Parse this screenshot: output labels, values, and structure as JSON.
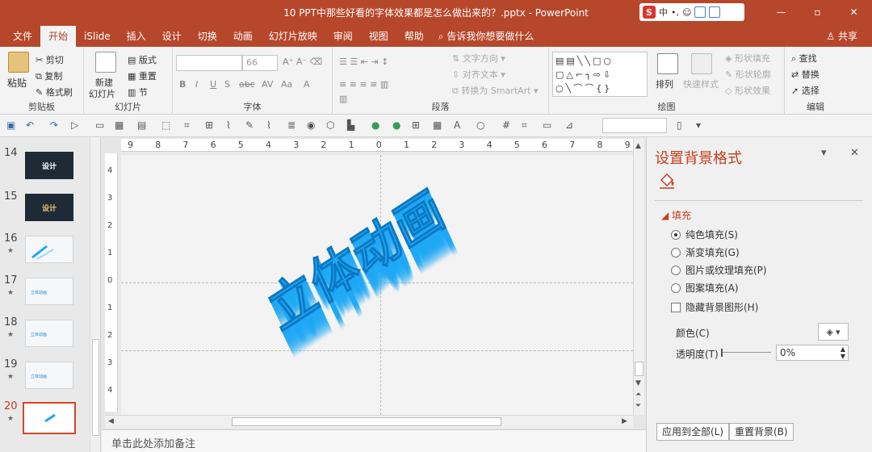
{
  "window": {
    "title": "10 PPT中那些好看的字体效果都是怎么做出来的？.pptx  -  PowerPoint",
    "controls": [
      "—",
      "▫",
      "✕"
    ],
    "ime": [
      "S",
      "中",
      "•,",
      "☺"
    ]
  },
  "tabs": [
    "文件",
    "开始",
    "iSlide",
    "插入",
    "设计",
    "切换",
    "动画",
    "幻灯片放映",
    "审阅",
    "视图",
    "帮助"
  ],
  "tell_me": "告诉我你想要做什么",
  "share": "共享",
  "ribbon": {
    "clipboard": {
      "paste": "粘贴",
      "cut": "剪切",
      "copy": "复制",
      "painter": "格式刷",
      "label": "剪贴板"
    },
    "slides": {
      "new_slide_1": "新建",
      "new_slide_2": "幻灯片",
      "layout": "版式",
      "reset": "重置",
      "section": "节",
      "label": "幻灯片"
    },
    "font": {
      "size": "66",
      "label": "字体",
      "buttons": [
        "B",
        "I",
        "U",
        "S",
        "abc",
        "AV",
        "Aa",
        "A"
      ]
    },
    "paragraph": {
      "text_direction": "文字方向",
      "align_text": "对齐文本",
      "smartart": "转换为 SmartArt",
      "label": "段落"
    },
    "drawing": {
      "arrange": "排列",
      "quick_styles": "快速样式",
      "fill": "形状填充",
      "outline": "形状轮廓",
      "effects": "形状效果",
      "label": "绘图",
      "shapes_row1": "▤▤╲╲□○",
      "shapes_row2": "▢△⌐┐⇨⇩",
      "shapes_row3": "○╲⌒⌒{}"
    },
    "editing": {
      "find": "查找",
      "replace": "替换",
      "select": "选择",
      "label": "编辑"
    }
  },
  "thumbnails": [
    {
      "num": "14",
      "text": "设计",
      "style": "dark",
      "star": ""
    },
    {
      "num": "15",
      "text": "设计",
      "style": "dark",
      "star": ""
    },
    {
      "num": "16",
      "text": "",
      "style": "light",
      "star": "★"
    },
    {
      "num": "17",
      "text": "立体动画",
      "style": "light",
      "star": "★"
    },
    {
      "num": "18",
      "text": "立体动画",
      "style": "light",
      "star": "★"
    },
    {
      "num": "19",
      "text": "立体动画",
      "style": "light",
      "star": "★"
    },
    {
      "num": "20",
      "text": "",
      "style": "selected",
      "star": "★"
    }
  ],
  "rulers": {
    "horizontal": [
      "9",
      "8",
      "7",
      "6",
      "5",
      "4",
      "3",
      "2",
      "1",
      "0",
      "1",
      "2",
      "3",
      "4",
      "5",
      "6",
      "7",
      "8",
      "9"
    ],
    "vertical": [
      "4",
      "3",
      "2",
      "1",
      "0",
      "1",
      "2",
      "3",
      "4"
    ]
  },
  "slide": {
    "art_text": "立体动画",
    "art_color": "#1ea8f5"
  },
  "notes_placeholder": "单击此处添加备注",
  "format_pane": {
    "title": "设置背景格式",
    "section": "填充",
    "options": [
      {
        "label": "纯色填充(S)",
        "type": "radio",
        "checked": true
      },
      {
        "label": "渐变填充(G)",
        "type": "radio",
        "checked": false
      },
      {
        "label": "图片或纹理填充(P)",
        "type": "radio",
        "checked": false
      },
      {
        "label": "图案填充(A)",
        "type": "radio",
        "checked": false
      },
      {
        "label": "隐藏背景图形(H)",
        "type": "checkbox",
        "checked": false
      }
    ],
    "color_label": "颜色(C)",
    "transparency_label": "透明度(T)",
    "transparency_value": "0%",
    "apply_all": "应用到全部(L)",
    "reset_bg": "重置背景(B)"
  }
}
